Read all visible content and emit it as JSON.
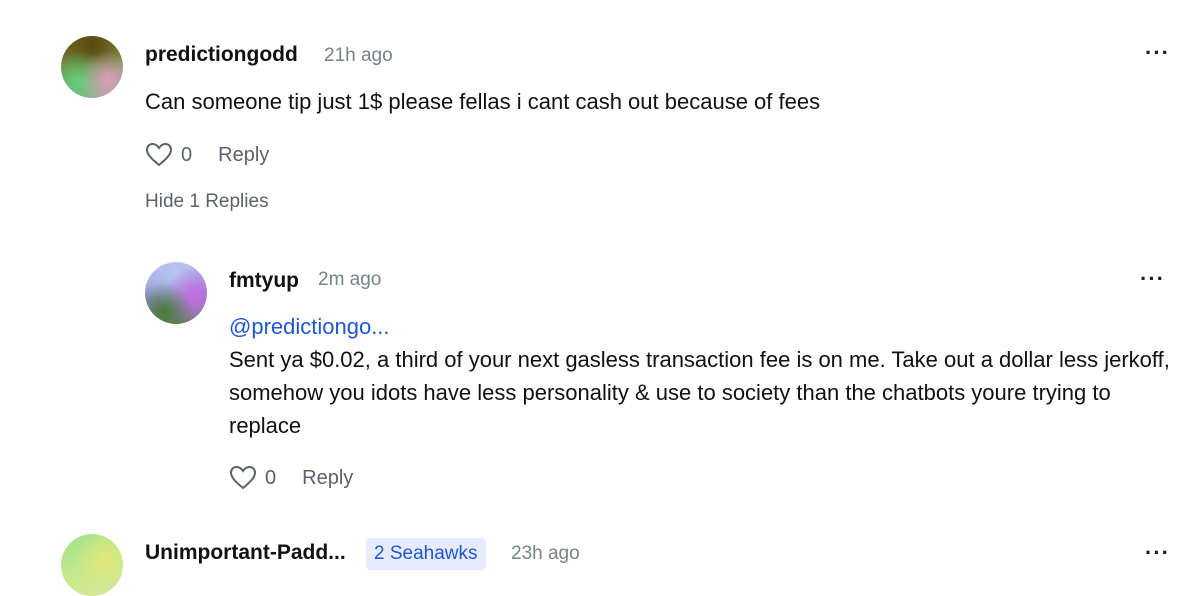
{
  "comments": [
    {
      "username": "predictiongodd",
      "time": "21h ago",
      "text": "Can someone tip just 1$ please fellas i cant cash out because of fees",
      "likes": "0",
      "reply_label": "Reply",
      "hide_replies_label": "Hide 1 Replies",
      "more_label": "···"
    },
    {
      "username": "fmtyup",
      "time": "2m ago",
      "mention": "@predictiongo...",
      "text": "Sent ya $0.02, a third of your next gasless transaction fee is on me. Take out a dollar less jerkoff, somehow you idots have less personality & use to society than the chatbots youre trying to replace",
      "likes": "0",
      "reply_label": "Reply",
      "more_label": "···"
    },
    {
      "username": "Unimportant-Padd...",
      "badge": "2 Seahawks",
      "time": "23h ago",
      "more_label": "···"
    }
  ],
  "icons": {
    "heart": "heart-outline-icon",
    "more": "more-dots-icon"
  },
  "colors": {
    "mention": "#1f56d6",
    "badge_bg": "#e6ecfb",
    "muted": "#7a8089"
  }
}
